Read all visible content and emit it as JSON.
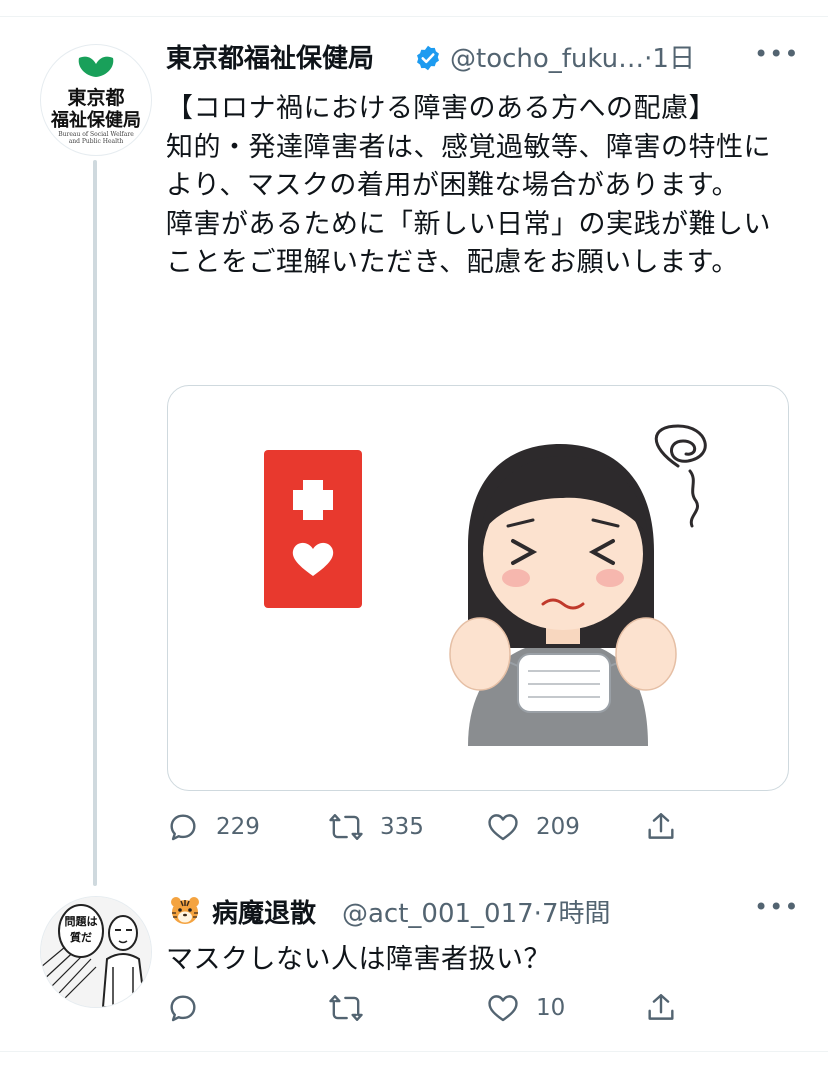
{
  "tweet1": {
    "author_name": "東京都福祉保健局",
    "verified": true,
    "handle_time": "@tocho_fuku…·1日",
    "avatar_logo": {
      "line1": "東京都",
      "line2": "福祉保健局",
      "english": "Bureau of Social Welfare and Public Health"
    },
    "text": "【コロナ禍における障害のある方への配慮】\n知的・発達障害者は、感覚過敏等、障害の特性により、マスクの着用が困難な場合があります。\n障害があるために「新しい日常」の実践が難しいことをご理解いただき、配慮をお願いします。",
    "media": {
      "card_icon": "help-mark-icon",
      "illustration": "woman-holding-mask-illustration"
    },
    "stats": {
      "replies": "229",
      "retweets": "335",
      "likes": "209"
    },
    "more_label": "•••"
  },
  "tweet2": {
    "author_emoji": "tiger-face-icon",
    "author_name": "病魔退散",
    "handle_time": "@act_001_017·7時間",
    "avatar_bubble_text": "問題は質だ",
    "text": "マスクしない人は障害者扱い？",
    "stats": {
      "replies": "",
      "retweets": "",
      "likes": "10"
    },
    "more_label": "•••"
  },
  "colors": {
    "secondary_text": "#536471",
    "verified_blue": "#1d9bf0",
    "divider": "#eff3f4",
    "thread_line": "#cfd9de",
    "help_mark_red": "#e8392e",
    "logo_green": "#19a05a"
  }
}
